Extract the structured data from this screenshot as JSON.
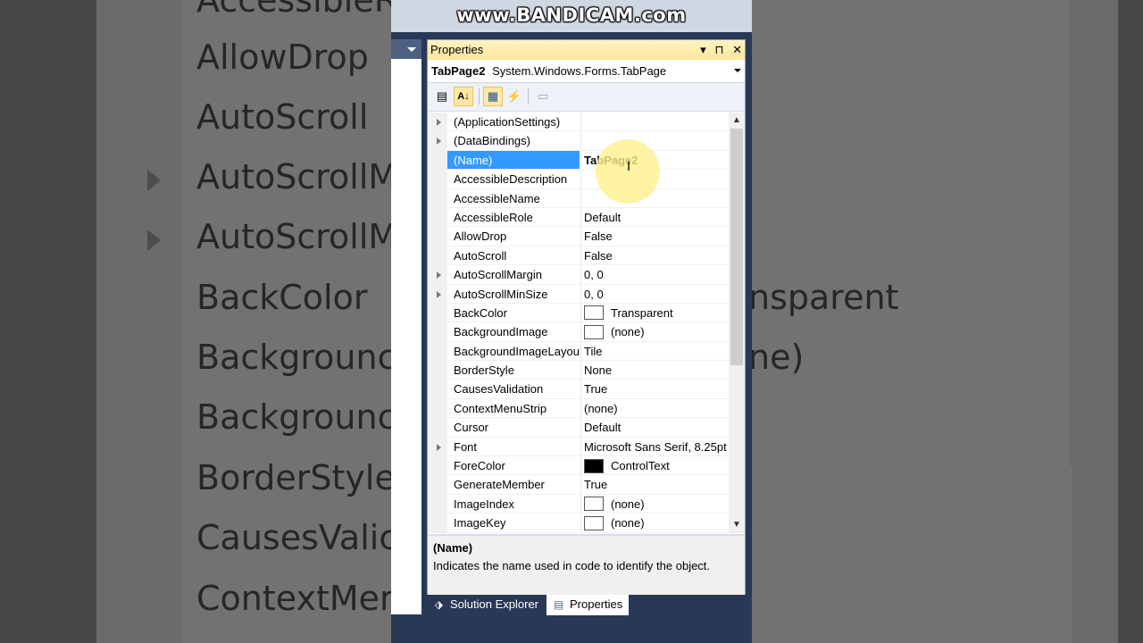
{
  "watermark": "www.BANDICAM.com",
  "background": {
    "rows": [
      "AllowDrop",
      "AutoScroll",
      "AutoScrollM",
      "AutoScrollM",
      "BackColor",
      "Backgrounc",
      "Backgrounc",
      "BorderStyle",
      "CausesValic",
      "ContextMer"
    ],
    "values": {
      "backcolor": "nsparent",
      "backgroundimage": "ne)"
    },
    "top_fragment": "AccessibleR"
  },
  "panel": {
    "title": "Properties",
    "pin_glyph": "▾",
    "dock_glyph": "⊓",
    "close_glyph": "✕"
  },
  "object_selector": {
    "name": "TabPage2",
    "type": "System.Windows.Forms.TabPage"
  },
  "toolbar": {
    "categorized": "▤",
    "alphabetical": "A↓",
    "properties": "▦",
    "events": "⚡",
    "property_pages": "▭"
  },
  "properties": [
    {
      "name": "(ApplicationSettings)",
      "value": "",
      "expand": true
    },
    {
      "name": "(DataBindings)",
      "value": "",
      "expand": true
    },
    {
      "name": "(Name)",
      "value": "TabPage2",
      "selected": true,
      "bold": true
    },
    {
      "name": "AccessibleDescription",
      "value": ""
    },
    {
      "name": "AccessibleName",
      "value": ""
    },
    {
      "name": "AccessibleRole",
      "value": "Default"
    },
    {
      "name": "AllowDrop",
      "value": "False"
    },
    {
      "name": "AutoScroll",
      "value": "False"
    },
    {
      "name": "AutoScrollMargin",
      "value": "0, 0",
      "expand": true
    },
    {
      "name": "AutoScrollMinSize",
      "value": "0, 0",
      "expand": true
    },
    {
      "name": "BackColor",
      "value": "Transparent",
      "swatch": "#ffffff"
    },
    {
      "name": "BackgroundImage",
      "value": "(none)",
      "swatch": "#ffffff"
    },
    {
      "name": "BackgroundImageLayout",
      "value": "Tile"
    },
    {
      "name": "BorderStyle",
      "value": "None"
    },
    {
      "name": "CausesValidation",
      "value": "True"
    },
    {
      "name": "ContextMenuStrip",
      "value": "(none)"
    },
    {
      "name": "Cursor",
      "value": "Default"
    },
    {
      "name": "Font",
      "value": "Microsoft Sans Serif, 8.25pt",
      "expand": true
    },
    {
      "name": "ForeColor",
      "value": "ControlText",
      "swatch": "#000000"
    },
    {
      "name": "GenerateMember",
      "value": "True"
    },
    {
      "name": "ImageIndex",
      "value": "(none)",
      "swatch": "#ffffff"
    },
    {
      "name": "ImageKey",
      "value": "(none)",
      "swatch": "#ffffff"
    }
  ],
  "description": {
    "title": "(Name)",
    "text": "Indicates the name used in code to identify the object."
  },
  "tabs": [
    {
      "label": "Solution Explorer",
      "icon": "solution-explorer-icon",
      "glyph": "⬗"
    },
    {
      "label": "Properties",
      "icon": "properties-icon",
      "glyph": "▤",
      "active": true
    }
  ]
}
